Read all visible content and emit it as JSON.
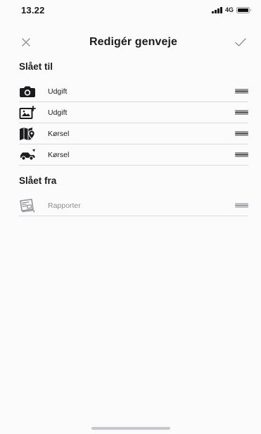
{
  "status_bar": {
    "time": "13.22",
    "network": "4G"
  },
  "nav": {
    "title": "Redigér genveje",
    "close_icon": "close-icon",
    "confirm_icon": "checkmark-icon"
  },
  "sections": {
    "enabled": {
      "title": "Slået til",
      "items": [
        {
          "label": "Udgift",
          "icon": "camera-icon"
        },
        {
          "label": "Udgift",
          "icon": "add-photo-icon"
        },
        {
          "label": "Kørsel",
          "icon": "map-pin-icon"
        },
        {
          "label": "Kørsel",
          "icon": "car-icon"
        }
      ]
    },
    "disabled": {
      "title": "Slået fra",
      "items": [
        {
          "label": "Rapporter",
          "icon": "report-icon"
        }
      ]
    }
  },
  "colors": {
    "text": "#1c1c1e",
    "muted": "#8e8e93",
    "separator": "#d9d9de",
    "background": "#fbfbfc"
  }
}
